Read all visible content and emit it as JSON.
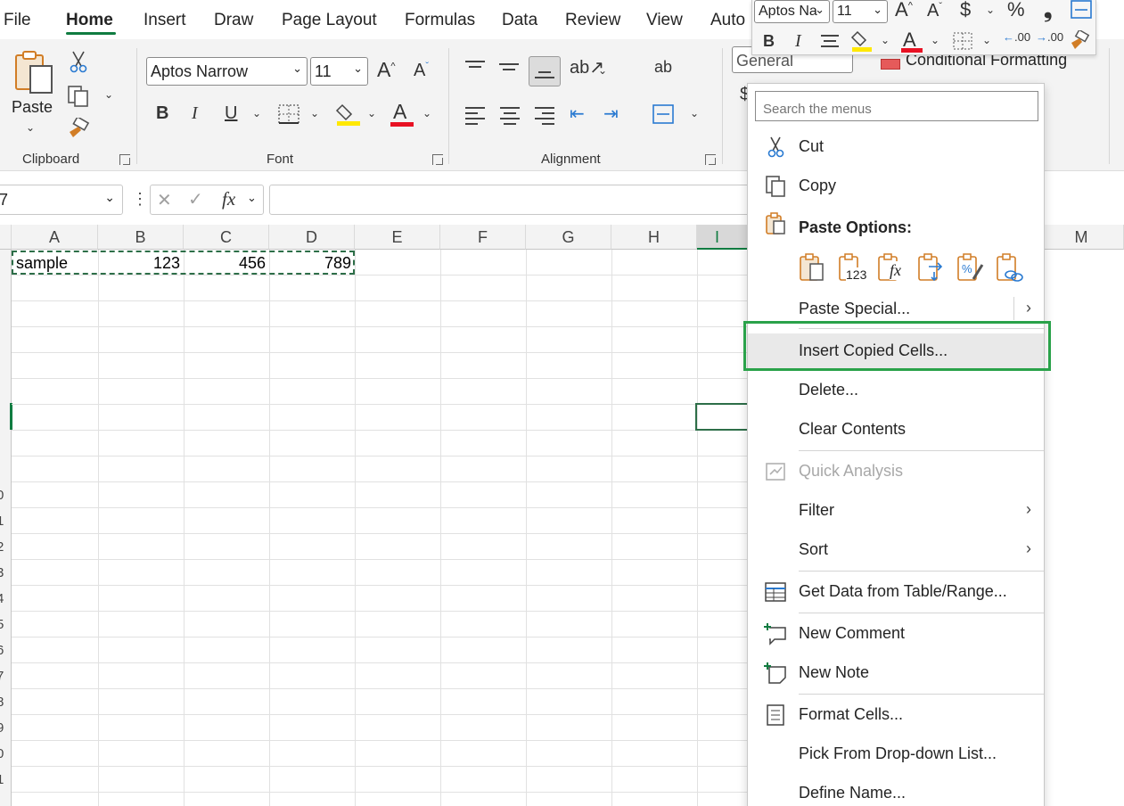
{
  "tabs": [
    {
      "label": "File",
      "active": false
    },
    {
      "label": "Home",
      "active": true
    },
    {
      "label": "Insert",
      "active": false
    },
    {
      "label": "Draw",
      "active": false
    },
    {
      "label": "Page Layout",
      "active": false
    },
    {
      "label": "Formulas",
      "active": false
    },
    {
      "label": "Data",
      "active": false
    },
    {
      "label": "Review",
      "active": false
    },
    {
      "label": "View",
      "active": false
    },
    {
      "label": "Auto",
      "active": false
    }
  ],
  "ribbon": {
    "clipboard": {
      "paste_label": "Paste",
      "group_label": "Clipboard"
    },
    "font": {
      "font_name": "Aptos Narrow",
      "font_size": "11",
      "group_label": "Font",
      "bold": "B",
      "italic": "I",
      "underline": "U",
      "grow": "A",
      "shrink": "A",
      "color_letter": "A"
    },
    "alignment": {
      "group_label": "Alignment",
      "wrap_glyph": "ab"
    },
    "number": {
      "format": "General",
      "dollar": "$"
    },
    "styles": {
      "conditional_formatting": "Conditional Formatting"
    }
  },
  "formula_bar": {
    "name_box": "7",
    "fx": "fx",
    "formula": ""
  },
  "columns": [
    "A",
    "B",
    "C",
    "D",
    "E",
    "F",
    "G",
    "H",
    "I",
    "M"
  ],
  "row_numbers": [
    "0",
    "1",
    "2",
    "3",
    "4",
    "5",
    "6",
    "7",
    "8",
    "9",
    "0",
    "1"
  ],
  "cells": {
    "a1": "sample",
    "b1": "123",
    "c1": "456",
    "d1": "789"
  },
  "mini_toolbar": {
    "font_name": "Aptos Na",
    "font_size": "11",
    "bold": "B",
    "italic": "I",
    "dollar": "$",
    "percent": "%",
    "comma": "❟",
    "color_letter": "A",
    "inc_dec": ".00",
    "dec_dec": ".00"
  },
  "context_menu": {
    "search_placeholder": "Search the menus",
    "cut": "Cut",
    "copy": "Copy",
    "paste_options": "Paste Options:",
    "paste_special": "Paste Special...",
    "insert_copied_cells": "Insert Copied Cells...",
    "delete": "Delete...",
    "clear_contents": "Clear Contents",
    "quick_analysis": "Quick Analysis",
    "filter": "Filter",
    "sort": "Sort",
    "get_data": "Get Data from Table/Range...",
    "new_comment": "New Comment",
    "new_note": "New Note",
    "format_cells": "Format Cells...",
    "pick_from_list": "Pick From Drop-down List...",
    "define_name": "Define Name...",
    "paste_opt_values": "123",
    "paste_opt_formulas": "fx"
  },
  "colors": {
    "excel_green": "#107c41",
    "highlight_box": "#2aa24a",
    "fill_yellow": "#ffe800",
    "font_red": "#e81123",
    "paste_orange": "#d17d26"
  }
}
